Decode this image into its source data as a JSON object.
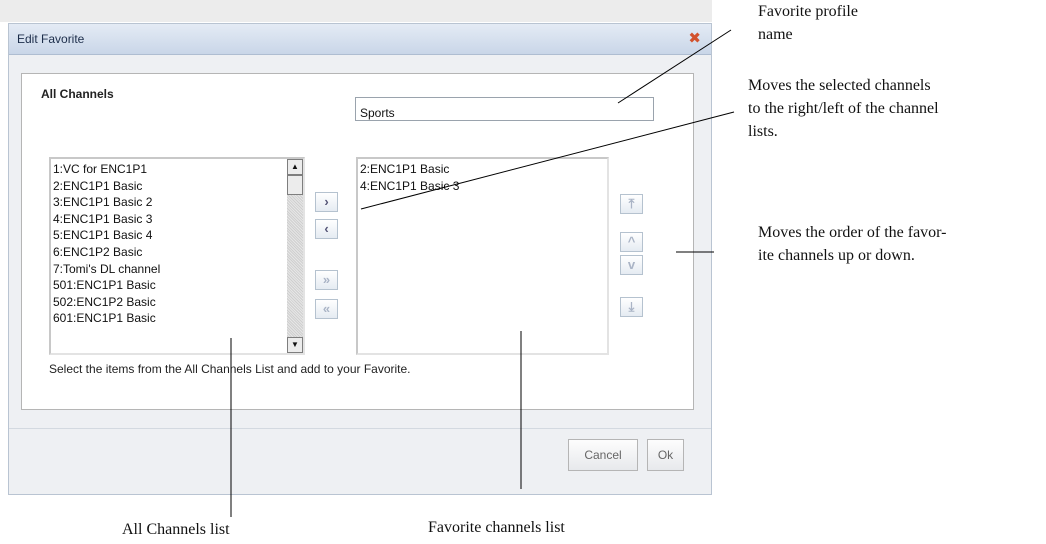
{
  "dialog": {
    "title": "Edit Favorite",
    "close_icon": "close-icon"
  },
  "panel": {
    "section_title": "All Channels",
    "profile_name_value": "Sports",
    "hint": "Select the items from the All Channels List and add to your Favorite."
  },
  "all_channels": [
    "1:VC for ENC1P1",
    "2:ENC1P1 Basic",
    "3:ENC1P1 Basic 2",
    "4:ENC1P1 Basic 3",
    "5:ENC1P1 Basic 4",
    "6:ENC1P2 Basic",
    "7:Tomi's DL channel",
    "501:ENC1P1 Basic",
    "502:ENC1P2 Basic",
    "601:ENC1P1 Basic"
  ],
  "favorite_channels": [
    "2:ENC1P1 Basic",
    "4:ENC1P1 Basic 3"
  ],
  "move_buttons": {
    "move_right": "›",
    "move_left": "‹",
    "move_all_right": "»",
    "move_all_left": "«"
  },
  "order_buttons": {
    "top": "⤒",
    "up": "^",
    "down": "v",
    "bottom": "⤓"
  },
  "footer": {
    "cancel_label": "Cancel",
    "ok_label": "Ok"
  },
  "annotations": {
    "profile_name_line1": "Favorite profile",
    "profile_name_line2": "name",
    "move_line1": "Moves the selected channels",
    "move_line2": "to the right/left of the channel",
    "move_line3": "lists.",
    "order_line1": "Moves the order of the favor-",
    "order_line2": "ite channels up or down.",
    "all_list": "All Channels list",
    "fav_list": "Favorite channels list"
  }
}
